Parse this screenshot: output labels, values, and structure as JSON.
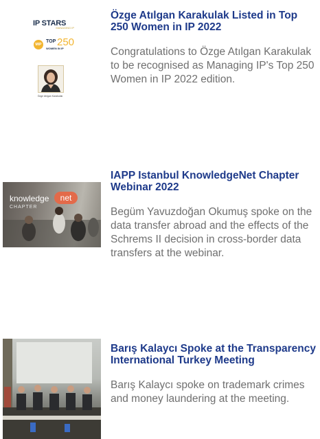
{
  "items": [
    {
      "headline": "Özge Atılgan Karakulak Listed in Top 250 Women in IP 2022",
      "body": "Congratulations to Özge Atılgan Karakulak to be recognised as Managing IP's Top 250 Women in IP 2022 edition.",
      "thumb": {
        "ipstars": "IP STARS",
        "ipstars_tag": "MANAGING IP",
        "mip": "MIP",
        "top": "TOP",
        "num": "250",
        "women": "WOMEN IN IP",
        "caption": "Özge Atılgan Karakulak"
      }
    },
    {
      "headline": "IAPP Istanbul KnowledgeNet Chapter Webinar 2022",
      "body": "Begüm Yavuzdoğan Okumuş spoke on the data transfer abroad and the effects of the Schrems II decision in cross-border data transfers at the webinar.",
      "thumb": {
        "word": "knowledge",
        "net": "net",
        "chapter": "CHAPTER"
      }
    },
    {
      "headline": "Barış Kalaycı Spoke at the Transparency International Turkey Meeting",
      "body": "Barış Kalaycı spoke on trademark crimes and money laundering at the meeting."
    }
  ],
  "colors": {
    "headline": "#1e3a8a",
    "body": "#6f6f6f",
    "gold": "#f2b530",
    "net_badge": "#e36a4a"
  }
}
